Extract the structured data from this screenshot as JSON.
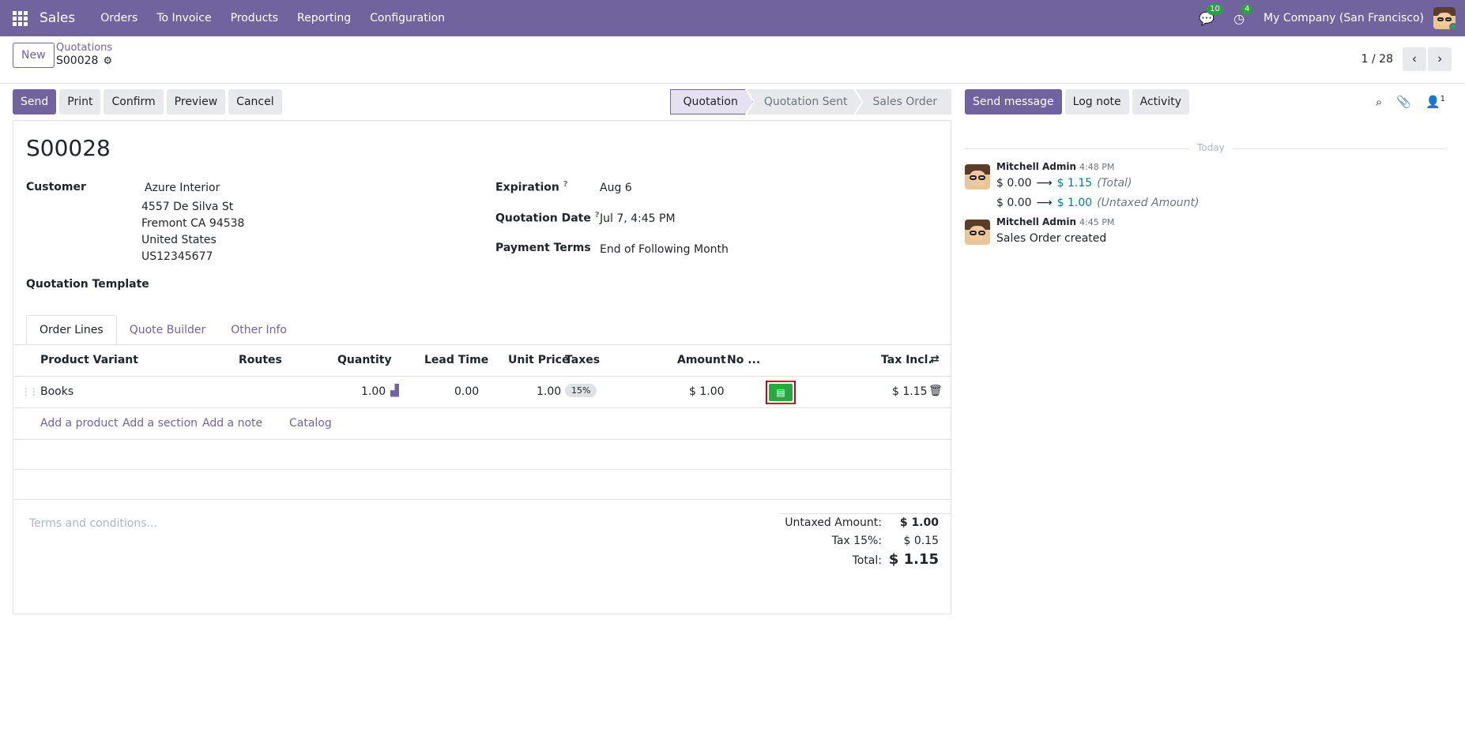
{
  "navbar": {
    "brand": "Sales",
    "menu": [
      "Orders",
      "To Invoice",
      "Products",
      "Reporting",
      "Configuration"
    ],
    "messages_count": "10",
    "activities_count": "4",
    "company": "My Company (San Francisco)"
  },
  "control": {
    "new_label": "New",
    "breadcrumb_parent": "Quotations",
    "breadcrumb_current": "S00028",
    "pager_value": "1 / 28"
  },
  "actions": {
    "send": "Send",
    "print": "Print",
    "confirm": "Confirm",
    "preview": "Preview",
    "cancel": "Cancel"
  },
  "stages": [
    "Quotation",
    "Quotation Sent",
    "Sales Order"
  ],
  "form": {
    "title": "S00028",
    "customer_label": "Customer",
    "customer_name": "Azure Interior",
    "address": [
      "4557 De Silva St",
      "Fremont CA 94538",
      "United States",
      "US12345677"
    ],
    "template_label": "Quotation Template",
    "expiration_label": "Expiration",
    "expiration_value": "Aug 6",
    "quotation_date_label": "Quotation Date",
    "quotation_date_value": "Jul 7, 4:45 PM",
    "payment_terms_label": "Payment Terms",
    "payment_terms_value": "End of Following Month",
    "help_mark": "?"
  },
  "tabs": [
    "Order Lines",
    "Quote Builder",
    "Other Info"
  ],
  "table": {
    "columns": [
      "Product Variant",
      "Routes",
      "Quantity",
      "Lead Time",
      "Unit Price",
      "Taxes",
      "Amount",
      "No ...",
      "Tax Incl."
    ],
    "row": {
      "product": "Books",
      "quantity": "1.00",
      "lead_time": "0.00",
      "unit_price": "1.00",
      "tax": "15%",
      "amount": "$ 1.00",
      "tax_incl": "$ 1.15"
    },
    "add_links": [
      "Add a product",
      "Add a section",
      "Add a note",
      "Catalog"
    ]
  },
  "terms_placeholder": "Terms and conditions...",
  "totals": {
    "untaxed_label": "Untaxed Amount:",
    "untaxed_value": "$ 1.00",
    "tax_label": "Tax 15%:",
    "tax_value": "$ 0.15",
    "total_label": "Total:",
    "total_value": "$ 1.15"
  },
  "chatter": {
    "send_message": "Send message",
    "log_note": "Log note",
    "activity": "Activity",
    "followers_count": "1",
    "today": "Today",
    "messages": [
      {
        "author": "Mitchell Admin",
        "time": "4:48 PM",
        "changes": [
          {
            "old": "$ 0.00",
            "new": "$ 1.15",
            "field": "(Total)"
          },
          {
            "old": "$ 0.00",
            "new": "$ 1.00",
            "field": "(Untaxed Amount)"
          }
        ]
      },
      {
        "author": "Mitchell Admin",
        "time": "4:45 PM",
        "body": "Sales Order created"
      }
    ]
  },
  "colors": {
    "brand": "#71639e",
    "success": "#28a745",
    "highlight": "#d0021b"
  }
}
